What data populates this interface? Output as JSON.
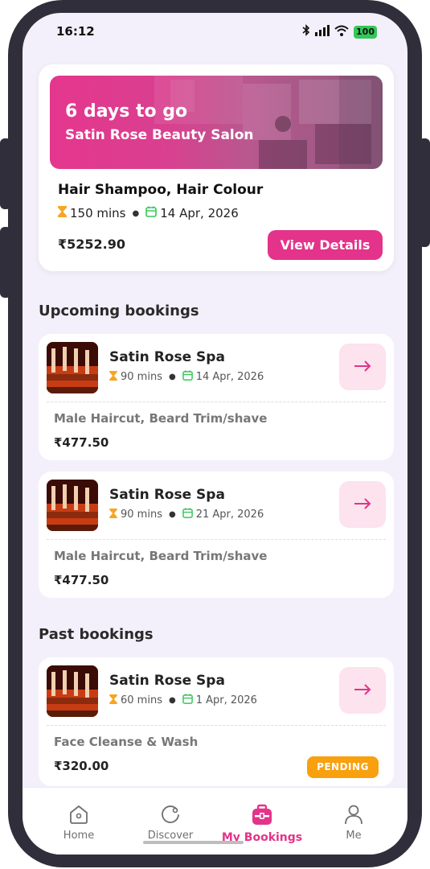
{
  "status_bar": {
    "time": "16:12",
    "battery": "100"
  },
  "hero": {
    "countdown": "6 days to go",
    "salon": "Satin Rose Beauty Salon",
    "services": "Hair Shampoo, Hair Colour",
    "duration": "150 mins",
    "date": "14 Apr, 2026",
    "price": "₹5252.90",
    "view_details_label": "View Details"
  },
  "sections": {
    "upcoming": "Upcoming bookings",
    "past": "Past bookings"
  },
  "upcoming": [
    {
      "salon": "Satin Rose Spa",
      "duration": "90 mins",
      "date": "14 Apr, 2026",
      "service": "Male Haircut, Beard Trim/shave",
      "price": "₹477.50"
    },
    {
      "salon": "Satin Rose Spa",
      "duration": "90 mins",
      "date": "21 Apr, 2026",
      "service": "Male Haircut, Beard Trim/shave",
      "price": "₹477.50"
    }
  ],
  "past": [
    {
      "salon": "Satin Rose Spa",
      "duration": "60 mins",
      "date": "1 Apr, 2026",
      "service": "Face Cleanse & Wash",
      "price": "₹320.00",
      "status": "PENDING"
    }
  ],
  "nav": {
    "home": "Home",
    "discover": "Discover",
    "my_bookings": "My Bookings",
    "me": "Me",
    "active": "my_bookings"
  },
  "colors": {
    "accent": "#e3338a",
    "pending": "#f9a00f",
    "hourglass": "#f5a623",
    "calendar": "#34c759",
    "background": "#f4f0fb"
  },
  "icons": [
    "hourglass-icon",
    "calendar-icon",
    "arrow-right-icon",
    "home-icon",
    "discover-icon",
    "bookings-icon",
    "profile-icon",
    "bluetooth-icon",
    "signal-icon",
    "wifi-icon",
    "battery-icon"
  ]
}
